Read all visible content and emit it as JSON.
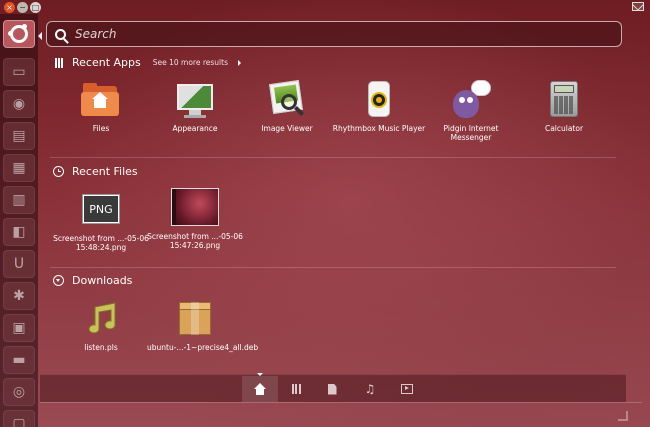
{
  "search": {
    "placeholder": "Search",
    "value": ""
  },
  "sections": {
    "recent_apps": {
      "title": "Recent Apps",
      "more": "See 10 more results",
      "items": [
        {
          "label": "Files",
          "icon": "files-folder-icon"
        },
        {
          "label": "Appearance",
          "icon": "appearance-monitor-icon"
        },
        {
          "label": "Image Viewer",
          "icon": "image-viewer-icon"
        },
        {
          "label": "Rhythmbox Music Player",
          "icon": "rhythmbox-icon"
        },
        {
          "label": "Pidgin Internet Messenger",
          "icon": "pidgin-icon"
        },
        {
          "label": "Calculator",
          "icon": "calculator-icon"
        }
      ]
    },
    "recent_files": {
      "title": "Recent Files",
      "items": [
        {
          "label": "Screenshot from ...-05-06 15:48:24.png",
          "icon_text": "PNG"
        },
        {
          "label": "Screenshot from ...-05-06 15:47:26.png"
        }
      ]
    },
    "downloads": {
      "title": "Downloads",
      "items": [
        {
          "label": "listen.pls"
        },
        {
          "label": "ubuntu-...-1~precise4_all.deb"
        }
      ]
    }
  },
  "lenses": [
    {
      "name": "home",
      "active": true
    },
    {
      "name": "applications",
      "active": false
    },
    {
      "name": "files",
      "active": false
    },
    {
      "name": "music",
      "active": false
    },
    {
      "name": "video",
      "active": false
    }
  ],
  "colors": {
    "accent": "#b9565c",
    "background": "#8a3138"
  }
}
